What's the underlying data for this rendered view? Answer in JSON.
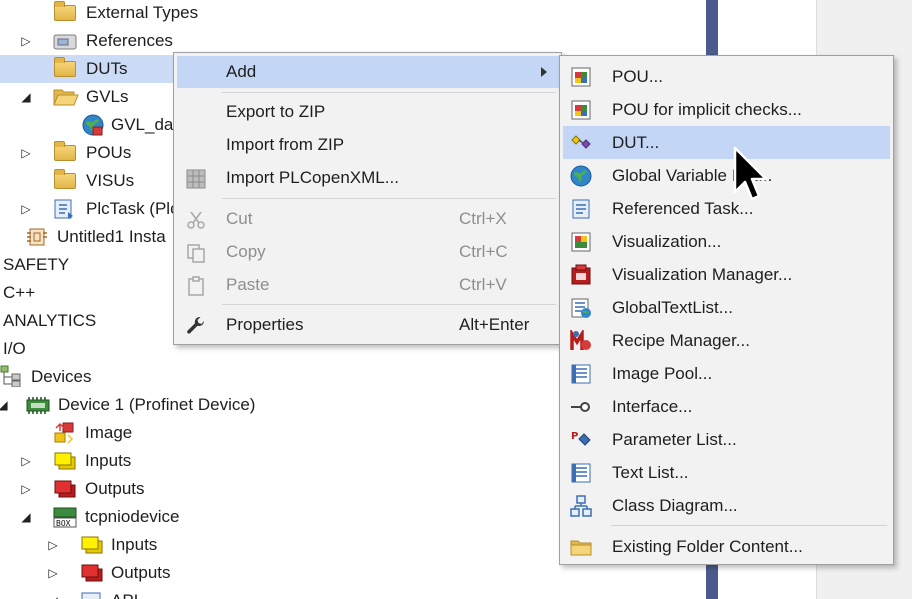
{
  "tree": {
    "items": [
      {
        "label": "External Types",
        "icon": "folder-icon",
        "caret": ""
      },
      {
        "label": "References",
        "icon": "references-icon",
        "caret": "collapsed"
      },
      {
        "label": "DUTs",
        "icon": "folder-icon",
        "caret": "",
        "selected": true
      },
      {
        "label": "GVLs",
        "icon": "folder-open-icon",
        "caret": "expanded"
      },
      {
        "label": "GVL_dat",
        "icon": "globe-icon",
        "caret": ""
      },
      {
        "label": "POUs",
        "icon": "folder-icon",
        "caret": "collapsed"
      },
      {
        "label": "VISUs",
        "icon": "folder-icon",
        "caret": ""
      },
      {
        "label": "PlcTask (Plc",
        "icon": "task-icon",
        "caret": "collapsed"
      },
      {
        "label": "Untitled1 Insta",
        "icon": "instance-icon",
        "caret": ""
      },
      {
        "label": "SAFETY",
        "icon": "",
        "caret": ""
      },
      {
        "label": "C++",
        "icon": "",
        "caret": ""
      },
      {
        "label": "ANALYTICS",
        "icon": "",
        "caret": ""
      },
      {
        "label": "I/O",
        "icon": "",
        "caret": ""
      },
      {
        "label": "Devices",
        "icon": "devices-icon",
        "caret": ""
      },
      {
        "label": "Device 1 (Profinet Device)",
        "icon": "device-icon",
        "caret": "expanded"
      },
      {
        "label": "Image",
        "icon": "image-icon",
        "caret": ""
      },
      {
        "label": "Inputs",
        "icon": "inputs-icon",
        "caret": "collapsed"
      },
      {
        "label": "Outputs",
        "icon": "outputs-icon",
        "caret": "collapsed"
      },
      {
        "label": "tcpniodevice",
        "icon": "box-icon",
        "caret": "expanded"
      },
      {
        "label": "Inputs",
        "icon": "inputs-icon",
        "caret": "collapsed"
      },
      {
        "label": "Outputs",
        "icon": "outputs-icon",
        "caret": "collapsed"
      },
      {
        "label": "API",
        "icon": "api-icon",
        "caret": "expanded"
      }
    ]
  },
  "context_menu": {
    "items": [
      {
        "label": "Add",
        "shortcut": "",
        "icon": "",
        "submenu": true,
        "highlighted": true,
        "disabled": false
      },
      {
        "label": "Export to ZIP",
        "shortcut": "",
        "icon": "",
        "disabled": false
      },
      {
        "label": "Import from ZIP",
        "shortcut": "",
        "icon": "",
        "disabled": false
      },
      {
        "label": "Import PLCopenXML...",
        "shortcut": "",
        "icon": "import-xml-icon",
        "disabled": false
      },
      {
        "label": "Cut",
        "shortcut": "Ctrl+X",
        "icon": "scissors-icon",
        "disabled": true
      },
      {
        "label": "Copy",
        "shortcut": "Ctrl+C",
        "icon": "copy-icon",
        "disabled": true
      },
      {
        "label": "Paste",
        "shortcut": "Ctrl+V",
        "icon": "paste-icon",
        "disabled": true
      },
      {
        "label": "Properties",
        "shortcut": "Alt+Enter",
        "icon": "wrench-icon",
        "disabled": false
      }
    ]
  },
  "submenu": {
    "items": [
      {
        "label": "POU...",
        "icon": "pou-icon"
      },
      {
        "label": "POU for implicit checks...",
        "icon": "pou-checks-icon"
      },
      {
        "label": "DUT...",
        "icon": "dut-icon",
        "highlighted": true
      },
      {
        "label": "Global Variable List...",
        "icon": "globe-icon"
      },
      {
        "label": "Referenced Task...",
        "icon": "referenced-task-icon"
      },
      {
        "label": "Visualization...",
        "icon": "visualization-icon"
      },
      {
        "label": "Visualization Manager...",
        "icon": "visualization-manager-icon"
      },
      {
        "label": "GlobalTextList...",
        "icon": "global-text-list-icon"
      },
      {
        "label": "Recipe Manager...",
        "icon": "recipe-manager-icon"
      },
      {
        "label": "Image Pool...",
        "icon": "image-pool-icon"
      },
      {
        "label": "Interface...",
        "icon": "interface-icon"
      },
      {
        "label": "Parameter List...",
        "icon": "parameter-list-icon"
      },
      {
        "label": "Text List...",
        "icon": "text-list-icon"
      },
      {
        "label": "Class Diagram...",
        "icon": "class-diagram-icon"
      },
      {
        "label": "Existing Folder Content...",
        "icon": "folder-icon"
      }
    ]
  },
  "colors": {
    "selection": "#ccdcf6",
    "menu_highlight": "#c3d6f5",
    "menu_background": "#f2f2f2",
    "side_strip": "#4b5a8c"
  }
}
